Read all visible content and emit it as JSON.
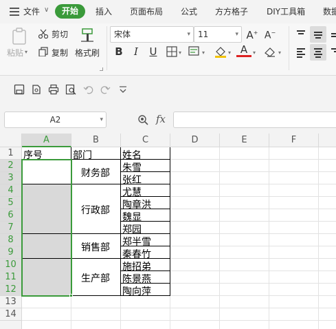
{
  "menu": {
    "file_label": "文件",
    "start_label": "开始",
    "tabs": [
      "插入",
      "页面布局",
      "公式",
      "方方格子",
      "DIY工具箱",
      "数据"
    ]
  },
  "ribbon": {
    "paste_label": "粘贴",
    "cut_label": "剪切",
    "copy_label": "复制",
    "format_painter_label": "格式刷",
    "font_name": "宋体",
    "font_size": "11",
    "bold_label": "B",
    "italic_label": "I",
    "underline_label": "U",
    "font_color_label": "A"
  },
  "formula_bar": {
    "name_box": "A2",
    "fx_label": "fx",
    "formula_value": ""
  },
  "sheet": {
    "columns": [
      "A",
      "B",
      "C",
      "D",
      "E",
      "F"
    ],
    "selected_column": "A",
    "rows": [
      "1",
      "2",
      "3",
      "4",
      "5",
      "6",
      "7",
      "8",
      "9",
      "10",
      "11",
      "12",
      "13",
      "14"
    ],
    "selected_rows": [
      "2",
      "3",
      "4",
      "5",
      "6",
      "7",
      "8",
      "9",
      "10",
      "11",
      "12"
    ],
    "headers": {
      "a1": "序号",
      "b1": "部门",
      "c1": "姓名"
    },
    "departments": [
      "财务部",
      "行政部",
      "销售部",
      "生产部"
    ],
    "names": [
      "朱雪",
      "张红",
      "尤慧",
      "陶章洪",
      "魏显",
      "郑园",
      "郑半雪",
      "秦春竹",
      "施招弟",
      "陈景燕",
      "陶向萍"
    ]
  },
  "colors": {
    "accent": "#3a9a3a",
    "selection_fill": "#d9d9d9"
  }
}
